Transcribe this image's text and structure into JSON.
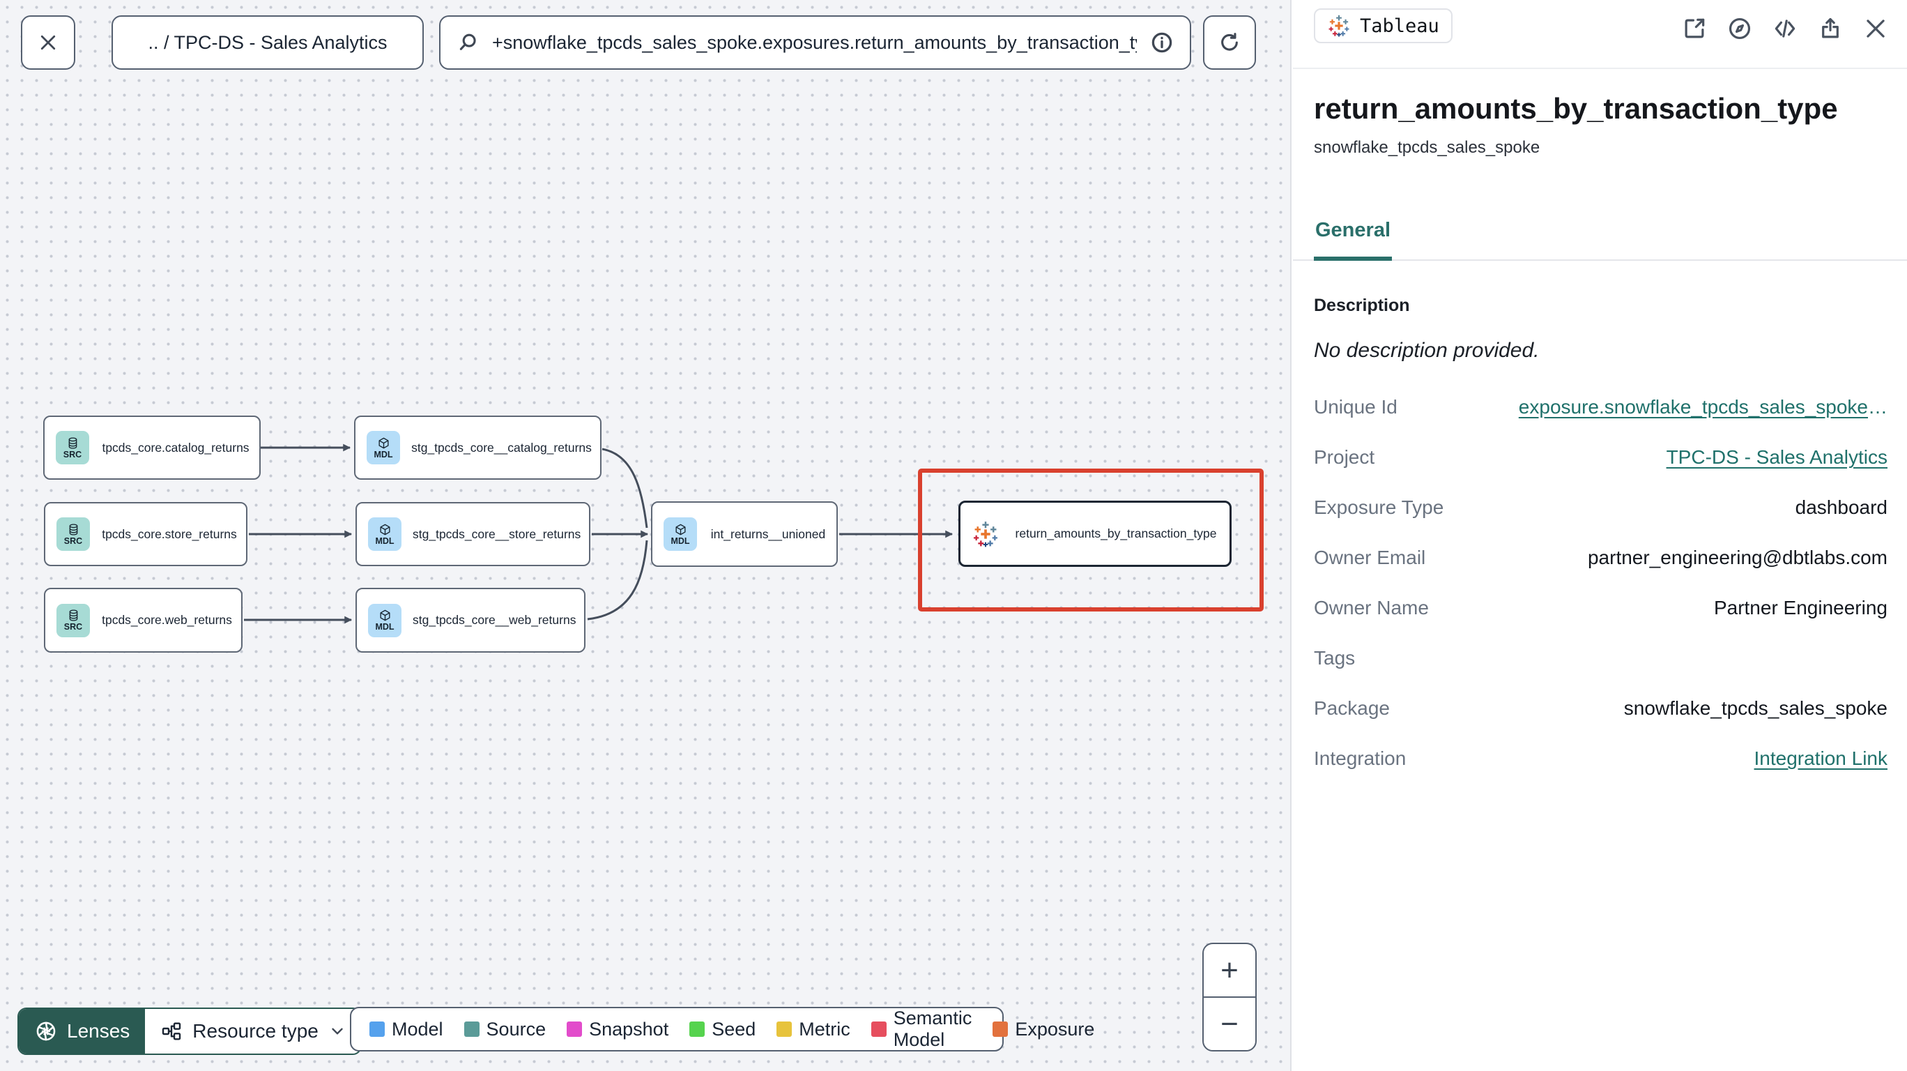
{
  "topbar": {
    "breadcrumb": ".. / TPC-DS - Sales Analytics",
    "search_value": "+snowflake_tpcds_sales_spoke.exposures.return_amounts_by_transaction_type"
  },
  "canvas": {
    "nodes": [
      {
        "label": "tpcds_core.catalog_returns",
        "badge_label": "SRC",
        "type": "source"
      },
      {
        "label": "tpcds_core.store_returns",
        "badge_label": "SRC",
        "type": "source"
      },
      {
        "label": "tpcds_core.web_returns",
        "badge_label": "SRC",
        "type": "source"
      },
      {
        "label": "stg_tpcds_core__catalog_returns",
        "badge_label": "MDL",
        "type": "model"
      },
      {
        "label": "stg_tpcds_core__store_returns",
        "badge_label": "MDL",
        "type": "model"
      },
      {
        "label": "stg_tpcds_core__web_returns",
        "badge_label": "MDL",
        "type": "model"
      },
      {
        "label": "int_returns__unioned",
        "badge_label": "MDL",
        "type": "model"
      },
      {
        "label": "return_amounts_by_transaction_type",
        "badge_icon": "tableau-icon",
        "type": "exposure",
        "selected": true
      }
    ],
    "edges": [
      [
        0,
        3
      ],
      [
        1,
        4
      ],
      [
        2,
        5
      ],
      [
        3,
        6
      ],
      [
        4,
        6
      ],
      [
        5,
        6
      ],
      [
        6,
        7
      ]
    ],
    "controls": {
      "lenses_label": "Lenses",
      "resource_type_label": "Resource type",
      "zoom_in": "+",
      "zoom_out": "−"
    },
    "legend": [
      {
        "label": "Model",
        "color": "#55a1ed"
      },
      {
        "label": "Source",
        "color": "#5b9b98"
      },
      {
        "label": "Snapshot",
        "color": "#e24ccb"
      },
      {
        "label": "Seed",
        "color": "#56d34e"
      },
      {
        "label": "Metric",
        "color": "#e7c33c"
      },
      {
        "label": "Semantic Model",
        "color": "#e64e5e"
      },
      {
        "label": "Exposure",
        "color": "#e2713d"
      }
    ]
  },
  "panel": {
    "platform_badge": "Tableau",
    "title": "return_amounts_by_transaction_type",
    "subtitle": "snowflake_tpcds_sales_spoke",
    "tab": "General",
    "description_heading": "Description",
    "description_text": "No description provided.",
    "rows": [
      {
        "label": "Unique Id",
        "value": "exposure.snowflake_tpcds_sales_spoke",
        "ellipsis": "…",
        "link": true
      },
      {
        "label": "Project",
        "value": "TPC-DS - Sales Analytics",
        "link": true
      },
      {
        "label": "Exposure Type",
        "value": "dashboard"
      },
      {
        "label": "Owner Email",
        "value": "partner_engineering@dbtlabs.com"
      },
      {
        "label": "Owner Name",
        "value": "Partner Engineering"
      },
      {
        "label": "Tags",
        "value": ""
      },
      {
        "label": "Package",
        "value": "snowflake_tpcds_sales_spoke"
      },
      {
        "label": "Integration",
        "value": "Integration Link",
        "link": true
      }
    ]
  },
  "icons": {
    "close-icon": "X",
    "search-icon": "magnifier",
    "info-icon": "circled i",
    "refresh-icon": "circular arrow",
    "external-link-icon": "box with outgoing arrow",
    "compass-icon": "compass",
    "code-icon": "</>",
    "share-icon": "box with up arrow",
    "lenses-icon": "aperture",
    "resource-type-icon": "org chart",
    "chevron-down-icon": "v",
    "database-icon": "cylinder",
    "cube-icon": "cube",
    "tableau-icon": "tableau plus marks",
    "plus-icon": "+",
    "minus-icon": "−"
  },
  "colors": {
    "accent_teal": "#20716b",
    "selection_red": "#d9402e",
    "lenses_bg": "#2a5a52",
    "source_badge_bg": "#a7dbd5",
    "model_badge_bg": "#b5ddf8",
    "canvas_bg": "#f3f4f7"
  }
}
